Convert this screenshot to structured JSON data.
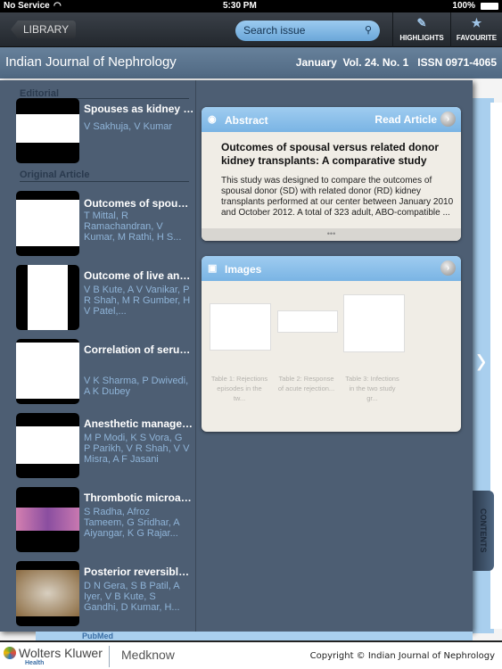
{
  "status": {
    "carrier": "No Service",
    "time": "5:30 PM",
    "battery": "100%"
  },
  "toolbar": {
    "library": "LIBRARY",
    "search_placeholder": "Search issue",
    "highlights": "HIGHLIGHTS",
    "favourite": "FAVOURITE"
  },
  "titlebar": {
    "journal": "Indian Journal of Nephrology",
    "meta": "January  Vol. 24. No. 1   ISSN 0971-4065"
  },
  "sections": {
    "editorial": "Editorial",
    "original": "Original Article"
  },
  "articles": [
    {
      "title": "Spouses as kidney donors: ...",
      "authors": "V Sakhuja, V Kumar"
    },
    {
      "title": "Outcomes of spousal...",
      "authors": "T Mittal, R Ramachandran, V Kumar, M Rathi, H S..."
    },
    {
      "title": "Outcome of live and de...",
      "authors": "V B Kute, A V Vanikar, P R Shah, M R Gumber, H V Patel,..."
    },
    {
      "title": "Correlation of serum...",
      "authors": "V K Sharma, P Dwivedi, A K Dubey"
    },
    {
      "title": "Anesthetic manageme...",
      "authors": "M P Modi, K S Vora, G P Parikh, V R Shah, V V Misra, A F Jasani"
    },
    {
      "title": "Thrombotic microangi...",
      "authors": "S Radha, Afroz Tameem, G Sridhar, A Aiyangar, K G Rajar..."
    },
    {
      "title": "Posterior reversible en...",
      "authors": "D N Gera, S B Patil, A Iyer, V B Kute, S Gandhi, D Kumar, H..."
    }
  ],
  "abstract": {
    "header": "Abstract",
    "read": "Read Article",
    "title": "Outcomes of spousal versus related donor kidney transplants: A comparative study",
    "text": "This study was designed to compare the outcomes of spousal donor (SD) with related donor (RD) kidney transplants performed at our center between January 2010 and October 2012. A total of 323 adult, ABO-compatible ...",
    "more": "•••"
  },
  "images": {
    "header": "Images",
    "captions": [
      "Table 1: Rejections episodes in the tw...",
      "Table 2: Response of acute rejection...",
      "Table 3: Infections in the two study gr..."
    ]
  },
  "contents_tab": "CONTENTS",
  "footer": {
    "pubmed": "PubMed",
    "brand": "Wolters Kluwer",
    "health": "Health",
    "medknow": "Medknow",
    "copyright": "Copyright © Indian Journal of Nephrology"
  }
}
